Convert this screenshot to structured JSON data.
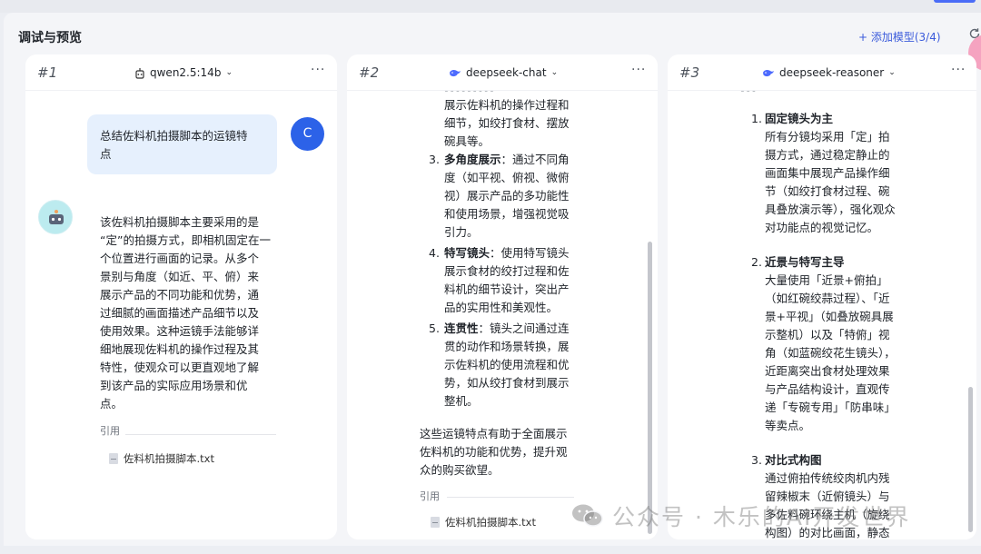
{
  "header": {
    "title": "调试与预览",
    "add_model": "+ 添加模型(3/4)",
    "refresh_icon": "refresh-icon"
  },
  "cards": [
    {
      "num": "#1",
      "model": "qwen2.5:14b",
      "model_icon": "robot-icon",
      "more": "···",
      "user_avatar": "C",
      "user_msg_lines": [
        "总结佐料机拍摄脚本的运镜特",
        "点"
      ],
      "answer_lines": [
        "该佐料机拍摄脚本主要采用的是",
        "“定”的拍摄方式，即相机固定在一",
        "个位置进行画面的记录。从多个",
        "景别与角度（如近、平、俯）来",
        "展示产品的不同功能和优势，通",
        "过细腻的画面描述产品细节以及",
        "使用效果。这种运镜手法能够详",
        "细地展现佐料机的操作过程及其",
        "特性，使观众可以更直观地了解",
        "到该产品的实际应用场景和优",
        "点。"
      ],
      "ref_label": "引用",
      "ref_file": "佐料机拍摄脚本.txt"
    },
    {
      "num": "#2",
      "model": "deepseek-chat",
      "model_icon": "whale-icon",
      "more": "···",
      "top_cut_line": "。。。。。。。。。",
      "prev_lines": [
        "展示佐料机的操作过程和",
        "细节，如绞打食材、摆放",
        "碗具等。"
      ],
      "items": [
        {
          "n": "3.",
          "title": "多角度展示",
          "lines": [
            "：通过不同角",
            "度（如平视、俯视、微俯",
            "视）展示产品的多功能性",
            "和使用场景，增强视觉吸",
            "引力。"
          ]
        },
        {
          "n": "4.",
          "title": "特写镜头",
          "lines": [
            "：使用特写镜头",
            "展示食材的绞打过程和佐",
            "料机的细节设计，突出产",
            "品的实用性和美观性。"
          ]
        },
        {
          "n": "5.",
          "title": "连贯性",
          "lines": [
            "：镜头之间通过连",
            "贯的动作和场景转换，展",
            "示佐料机的使用流程和优",
            "势，如从绞打食材到展示",
            "整机。"
          ]
        }
      ],
      "summary_lines": [
        "这些运镜特点有助于全面展示",
        "佐料机的功能和优势，提升观",
        "众的购买欲望。"
      ],
      "ref_label": "引用",
      "ref_file": "佐料机拍摄脚本.txt"
    },
    {
      "num": "#3",
      "model": "deepseek-reasoner",
      "model_icon": "whale-icon",
      "more": "···",
      "top_cut_line": "。。。",
      "items": [
        {
          "n": "1.",
          "title": "固定镜头为主",
          "lines": [
            "所有分镜均采用「定」拍",
            "摄方式，通过稳定静止的",
            "画面集中展现产品操作细",
            "节（如绞打食材过程、碗",
            "具叠放演示等），强化观众",
            "对功能点的视觉记忆。"
          ]
        },
        {
          "n": "2.",
          "title": "近景与特写主导",
          "lines": [
            "大量使用「近景+俯拍」",
            "（如红碗绞蒜过程）、「近",
            "景+平视」（如叠放碗具展",
            "示整机）以及「特俯」视",
            "角（如蓝碗绞花生镜头），",
            "近距离突出食材处理效果",
            "与产品结构设计，直观传",
            "递「专碗专用」「防串味」",
            "等卖点。"
          ]
        },
        {
          "n": "3.",
          "title": "对比式构图",
          "lines": [
            "通过俯拍传统绞肉机内残",
            "留辣椒末（近俯镜头）与",
            "多佐料碗环绕主机（旋绕",
            "构图）的对比画面，静态"
          ]
        }
      ]
    }
  ],
  "watermark": "公众号 · 木乐的AI开发世界"
}
